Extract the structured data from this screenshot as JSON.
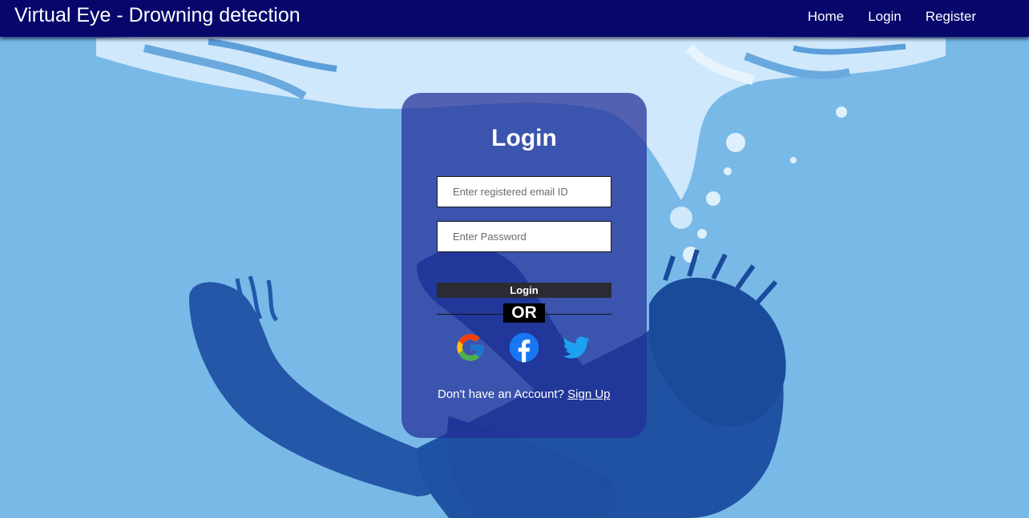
{
  "navbar": {
    "brand": "Virtual Eye - Drowning detection",
    "links": [
      "Home",
      "Login",
      "Register"
    ]
  },
  "login": {
    "title": "Login",
    "email_placeholder": "Enter registered email ID",
    "password_placeholder": "Enter Password",
    "submit_label": "Login",
    "or_label": "OR",
    "social_icons": [
      "google-icon",
      "facebook-icon",
      "twitter-icon"
    ],
    "signup_prompt": "Don't have an Account?",
    "signup_link": "Sign Up"
  },
  "colors": {
    "navbar_bg": "#06066b",
    "page_bg": "#79b9e8",
    "card_bg": "#222c96",
    "button_bg": "#2b2b33"
  }
}
